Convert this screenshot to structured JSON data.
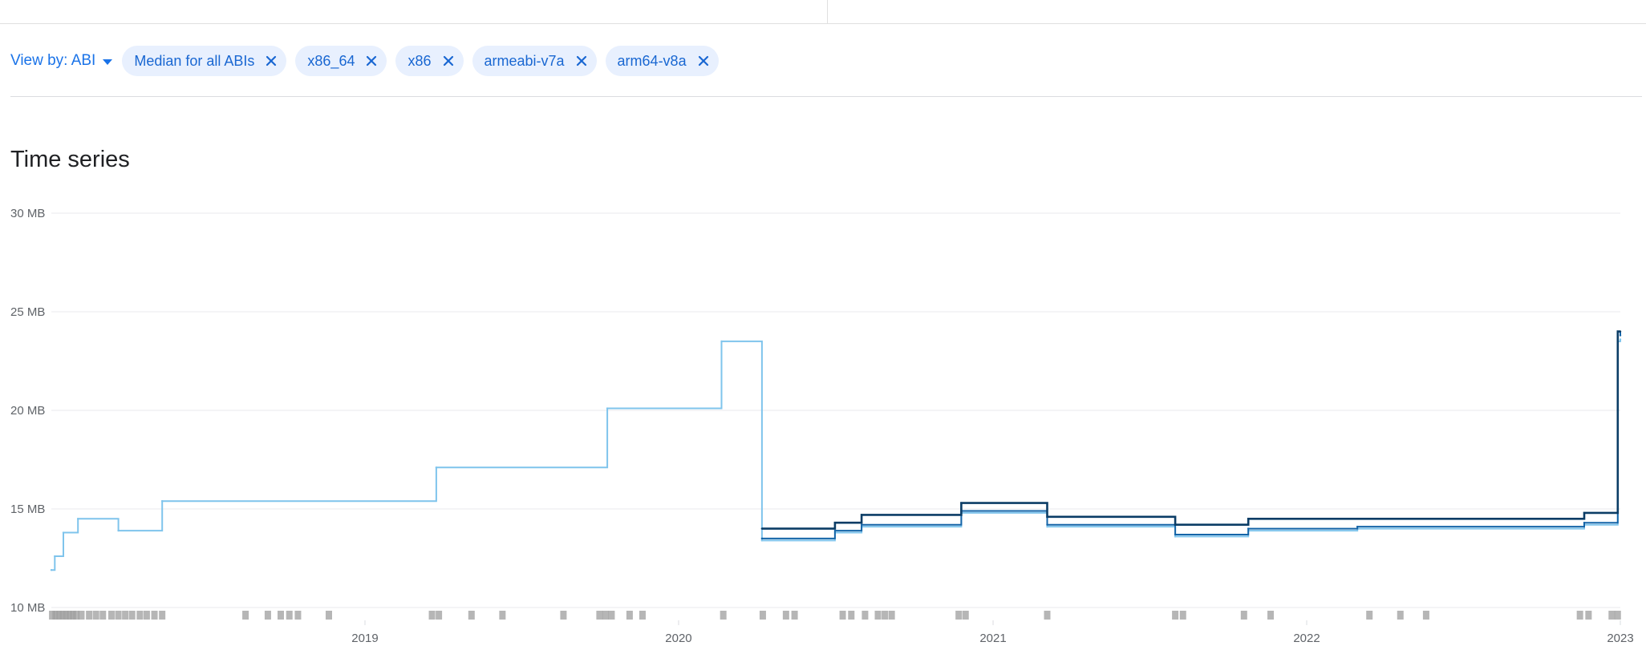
{
  "filters": {
    "view_by_label": "View by: ABI",
    "chips": [
      {
        "label": "Median for all ABIs"
      },
      {
        "label": "x86_64"
      },
      {
        "label": "x86"
      },
      {
        "label": "armeabi-v7a"
      },
      {
        "label": "arm64-v8a"
      }
    ]
  },
  "section_title": "Time series",
  "colors": {
    "accent": "#1a73e8",
    "chip_bg": "#e8f0fe",
    "series_dark": "#0b3d66",
    "series_mid": "#1565a8",
    "series_light": "#7fc4ec",
    "release_marker": "#9e9e9e"
  },
  "chart_data": {
    "type": "line",
    "step": true,
    "xlim": [
      "2018-01-01",
      "2023-01-01"
    ],
    "ylim": [
      10,
      30
    ],
    "x_ticks": [
      "2019",
      "2020",
      "2021",
      "2022",
      "2023"
    ],
    "y_ticks": [
      "10 MB",
      "15 MB",
      "20 MB",
      "25 MB",
      "30 MB"
    ],
    "y_tick_values": [
      10,
      15,
      20,
      25,
      30
    ],
    "grid": true,
    "series": [
      {
        "color": "#0b3d66",
        "points": [
          [
            "2020-04-07",
            14.0
          ],
          [
            "2020-07-01",
            14.3
          ],
          [
            "2020-08-01",
            14.7
          ],
          [
            "2020-11-25",
            15.3
          ],
          [
            "2021-03-05",
            14.6
          ],
          [
            "2021-08-01",
            14.2
          ],
          [
            "2021-10-25",
            14.5
          ],
          [
            "2022-03-01",
            14.5
          ],
          [
            "2022-11-20",
            14.8
          ],
          [
            "2022-12-29",
            24.0
          ],
          [
            "2023-01-01",
            24.0
          ]
        ]
      },
      {
        "color": "#1565a8",
        "points": [
          [
            "2020-04-07",
            13.5
          ],
          [
            "2020-07-01",
            13.9
          ],
          [
            "2020-08-01",
            14.2
          ],
          [
            "2020-11-25",
            14.9
          ],
          [
            "2021-03-05",
            14.2
          ],
          [
            "2021-08-01",
            13.7
          ],
          [
            "2021-10-25",
            14.0
          ],
          [
            "2022-03-01",
            14.1
          ],
          [
            "2022-11-20",
            14.3
          ],
          [
            "2022-12-29",
            24.0
          ],
          [
            "2023-01-01",
            23.8
          ]
        ]
      },
      {
        "color": "#7fc4ec",
        "points": [
          [
            "2018-01-01",
            11.9
          ],
          [
            "2018-01-05",
            12.6
          ],
          [
            "2018-01-15",
            13.8
          ],
          [
            "2018-02-01",
            14.5
          ],
          [
            "2018-03-20",
            13.9
          ],
          [
            "2018-05-10",
            15.4
          ],
          [
            "2019-03-25",
            17.1
          ],
          [
            "2019-10-10",
            20.1
          ],
          [
            "2020-02-20",
            23.5
          ],
          [
            "2020-04-07",
            13.4
          ],
          [
            "2020-07-01",
            13.8
          ],
          [
            "2020-08-01",
            14.1
          ],
          [
            "2020-11-25",
            14.8
          ],
          [
            "2021-03-05",
            14.1
          ],
          [
            "2021-08-01",
            13.6
          ],
          [
            "2021-10-25",
            13.9
          ],
          [
            "2022-03-01",
            14.0
          ],
          [
            "2022-11-20",
            14.2
          ],
          [
            "2022-12-29",
            23.5
          ],
          [
            "2023-01-01",
            23.6
          ]
        ]
      }
    ],
    "release_markers": [
      "2018-01-02",
      "2018-01-06",
      "2018-01-10",
      "2018-01-14",
      "2018-01-18",
      "2018-01-22",
      "2018-01-26",
      "2018-01-30",
      "2018-02-05",
      "2018-02-14",
      "2018-02-22",
      "2018-03-02",
      "2018-03-12",
      "2018-03-20",
      "2018-03-28",
      "2018-04-05",
      "2018-04-14",
      "2018-04-22",
      "2018-05-01",
      "2018-05-10",
      "2018-08-15",
      "2018-09-10",
      "2018-09-25",
      "2018-10-05",
      "2018-10-15",
      "2018-11-20",
      "2019-03-20",
      "2019-03-28",
      "2019-05-05",
      "2019-06-10",
      "2019-08-20",
      "2019-10-01",
      "2019-10-08",
      "2019-10-15",
      "2019-11-05",
      "2019-11-20",
      "2020-02-22",
      "2020-04-08",
      "2020-05-05",
      "2020-05-15",
      "2020-07-10",
      "2020-07-20",
      "2020-08-05",
      "2020-08-20",
      "2020-08-28",
      "2020-09-05",
      "2020-11-22",
      "2020-11-30",
      "2021-03-05",
      "2021-08-01",
      "2021-08-10",
      "2021-10-20",
      "2021-11-20",
      "2022-03-15",
      "2022-04-20",
      "2022-05-20",
      "2022-11-15",
      "2022-11-25",
      "2022-12-22",
      "2022-12-29"
    ]
  }
}
